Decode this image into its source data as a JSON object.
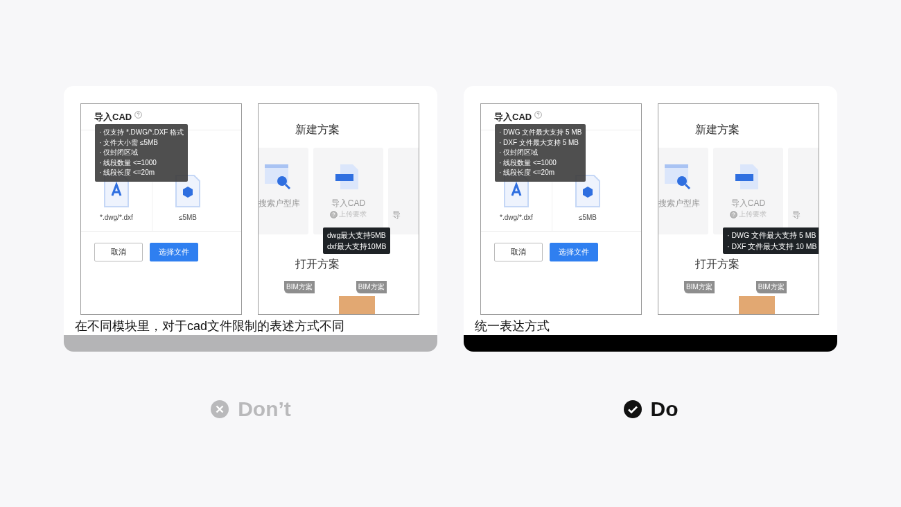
{
  "examples": [
    {
      "kind": "dont",
      "caption": "在不同模块里，对于cad文件限制的表述方式不同",
      "verdict": "Don’t",
      "dialog": {
        "title": "导入CAD",
        "tooltip": [
          "· 仅支持 *.DWG/*.DXF 格式",
          "· 文件大小需 ≤5MB",
          "· 仅封闭区域",
          "· 线段数量 <=1000",
          "· 线段长度 <=20m"
        ],
        "files": [
          {
            "kind": "cad",
            "label": "*.dwg/*.dxf"
          },
          {
            "kind": "cube",
            "label": "≤5MB"
          }
        ],
        "buttons": [
          {
            "label": "取消",
            "primary": false
          },
          {
            "label": "选择文件",
            "primary": true
          }
        ]
      },
      "home": {
        "title": "新建方案",
        "cards": [
          {
            "kind": "search",
            "label": "搜索户型库"
          },
          {
            "kind": "cad",
            "label": "导入CAD",
            "hint": "上传要求"
          },
          {
            "kind": "cut",
            "label": "导"
          }
        ],
        "tooltip": [
          "dwg最大支持5MB",
          "dxf最大支持10MB"
        ],
        "section": "打开方案",
        "tags": [
          "BIM方案",
          "BIM方案"
        ]
      }
    },
    {
      "kind": "do",
      "caption": "统一表达方式",
      "verdict": "Do",
      "dialog": {
        "title": "导入CAD",
        "tooltip": [
          "· DWG 文件最大支持 5 MB",
          "· DXF 文件最大支持 5 MB",
          "· 仅封闭区域",
          "· 线段数量 <=1000",
          "· 线段长度 <=20m"
        ],
        "files": [
          {
            "kind": "cad",
            "label": "*.dwg/*.dxf"
          },
          {
            "kind": "cube",
            "label": "≤5MB"
          }
        ],
        "buttons": [
          {
            "label": "取消",
            "primary": false
          },
          {
            "label": "选择文件",
            "primary": true
          }
        ]
      },
      "home": {
        "title": "新建方案",
        "cards": [
          {
            "kind": "search",
            "label": "搜索户型库"
          },
          {
            "kind": "cad",
            "label": "导入CAD",
            "hint": "上传要求"
          },
          {
            "kind": "cut",
            "label": "导"
          }
        ],
        "tooltip": [
          "· DWG 文件最大支持 5 MB",
          "· DXF 文件最大支持 10 MB"
        ],
        "section": "打开方案",
        "tags": [
          "BIM方案",
          "BIM方案"
        ]
      }
    }
  ]
}
